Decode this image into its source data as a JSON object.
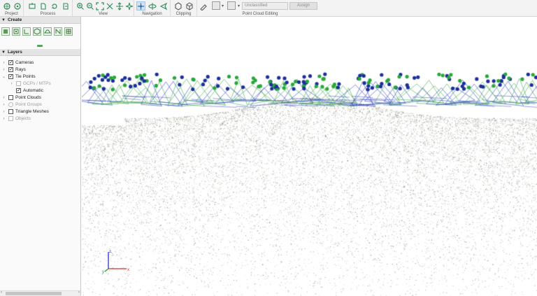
{
  "ribbon": {
    "groups": [
      {
        "label": "Project",
        "icons": [
          "open-project-icon",
          "georeference-icon"
        ]
      },
      {
        "label": "Process",
        "icons": [
          "add-photos-icon",
          "open-file-icon",
          "reprocess-icon",
          "export-icon"
        ]
      },
      {
        "label": "View",
        "icons": [
          "zoom-in-icon",
          "zoom-out-icon",
          "zoom-extent-icon",
          "zoom-fit-icon",
          "pan-view-icon",
          "aerial-view-icon"
        ]
      },
      {
        "label": "Navigation",
        "icons": [
          "navigate-icon",
          "orbit-icon",
          "fly-icon"
        ]
      },
      {
        "label": "Clipping",
        "icons": [
          "clip-box-icon",
          "clip-plane-icon"
        ]
      },
      {
        "label": "Point Cloud Editing",
        "icons": [
          "brush-icon",
          "selection-icon"
        ]
      }
    ],
    "class_select": "Unclassified",
    "assign_label": "Assign"
  },
  "panel": {
    "create_title": "Create",
    "create_tools": [
      "new-mtp-icon",
      "new-ortho-region-icon",
      "new-polyline-icon",
      "new-volume-icon",
      "new-surface-icon",
      "new-measure-icon",
      "new-grid-icon"
    ],
    "layers_title": "Layers",
    "layers": [
      {
        "label": "Cameras",
        "level": 0,
        "checked": true,
        "expand": "›"
      },
      {
        "label": "Rays",
        "level": 0,
        "checked": true,
        "expand": "›"
      },
      {
        "label": "Tie Points",
        "level": 0,
        "checked": true,
        "expand": "⌄"
      },
      {
        "label": "GCPs / MTPs",
        "level": 1,
        "checked": false,
        "expand": "›",
        "disabled": true
      },
      {
        "label": "Automatic",
        "level": 1,
        "checked": true,
        "expand": ""
      },
      {
        "label": "Point Clouds",
        "level": 0,
        "checked": false,
        "expand": "›"
      },
      {
        "label": "Point Groups",
        "level": 0,
        "checked": false,
        "expand": "›",
        "disabled": true,
        "radio": true
      },
      {
        "label": "Triangle Meshes",
        "level": 0,
        "checked": false,
        "expand": "›"
      },
      {
        "label": "Objects",
        "level": 0,
        "checked": false,
        "expand": "›",
        "disabled": true
      }
    ]
  },
  "viewport": {
    "axis_labels": [
      "z",
      "y",
      "x"
    ],
    "colors": {
      "camera_blue": "#1c2f9a",
      "camera_green": "#28a83a",
      "ray_blue": "#2b3fc4",
      "ray_green": "#3da84a",
      "axis_x": "#d93030",
      "axis_y": "#2a9a2a",
      "axis_z": "#3030d9"
    }
  }
}
